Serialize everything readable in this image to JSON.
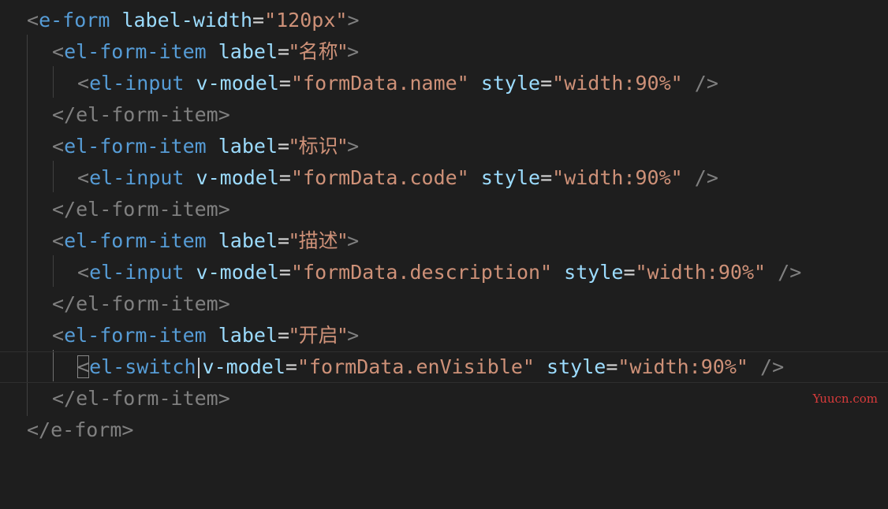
{
  "editor": {
    "lines": [
      {
        "tag": "e-form",
        "attr": "label-width",
        "value": "\"120px\""
      },
      {
        "tag": "el-form-item",
        "attr": "label",
        "value": "\"名称\""
      },
      {
        "tag": "el-input",
        "attr1": "v-model",
        "val1": "\"formData.name\"",
        "attr2": "style",
        "val2": "\"width:90%\"",
        "close": "/>"
      },
      {
        "closing": "</el-form-item>"
      },
      {
        "tag": "el-form-item",
        "attr": "label",
        "value": "\"标识\""
      },
      {
        "tag": "el-input",
        "attr1": "v-model",
        "val1": "\"formData.code\"",
        "attr2": "style",
        "val2": "\"width:90%\"",
        "close": "/>"
      },
      {
        "closing": "</el-form-item>"
      },
      {
        "tag": "el-form-item",
        "attr": "label",
        "value": "\"描述\""
      },
      {
        "tag": "el-input",
        "attr1": "v-model",
        "val1": "\"formData.description\"",
        "attr2": "style",
        "val2": "\"width:90%\"",
        "close": "/>"
      },
      {
        "closing": "</el-form-item>"
      },
      {
        "tag": "el-form-item",
        "attr": "label",
        "value": "\"开启\""
      },
      {
        "tag": "el-switch",
        "attr1": "v-model",
        "val1": "\"formData.enVisible\"",
        "attr2": "style",
        "val2": "\"width:90%\"",
        "close": "/>"
      },
      {
        "closing": "</el-form-item>"
      },
      {
        "closing": "</e-form>"
      }
    ]
  },
  "watermark": "Yuucn.com",
  "colors": {
    "background": "#1e1e1e",
    "tag": "#569cd6",
    "attribute": "#9cdcfe",
    "string": "#ce9178",
    "bracket": "#808080",
    "watermark": "#d83b3b"
  }
}
